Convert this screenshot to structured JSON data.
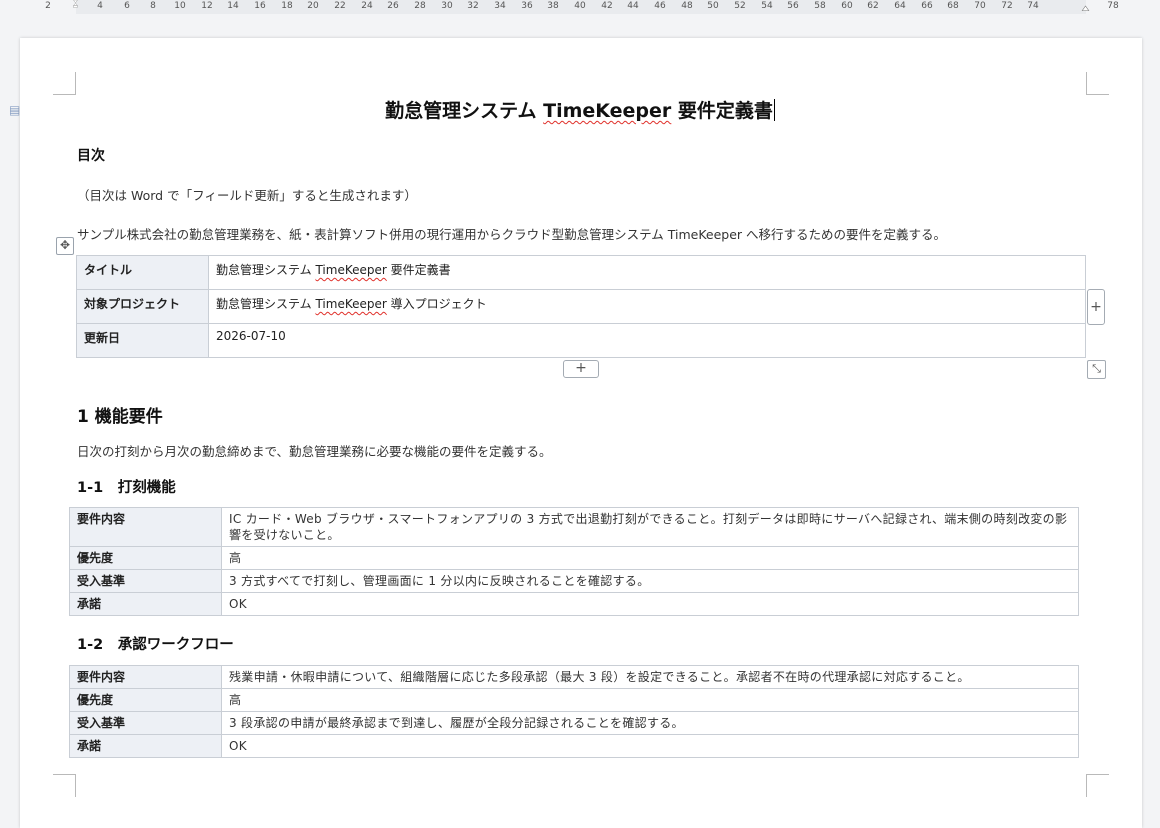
{
  "ruler": {
    "numbers": [
      "2",
      "2",
      "4",
      "6",
      "8",
      "10",
      "12",
      "14",
      "16",
      "18",
      "20",
      "22",
      "24",
      "26",
      "28",
      "30",
      "32",
      "34",
      "36",
      "38",
      "40",
      "42",
      "44",
      "46",
      "48",
      "50",
      "52",
      "54",
      "56",
      "58",
      "60",
      "62",
      "64",
      "66",
      "68",
      "70",
      "72",
      "74",
      "78"
    ]
  },
  "document": {
    "title_pre": "勤怠管理システム ",
    "title_brand": "TimeKeeper",
    "title_post": " 要件定義書",
    "toc_heading": "目次",
    "toc_note": "（目次は Word で「フィールド更新」すると生成されます）",
    "intro": "サンプル株式会社の勤怠管理業務を、紙・表計算ソフト併用の現行運用からクラウド型勤怠管理システム TimeKeeper へ移行するための要件を定義する。"
  },
  "meta_table": {
    "rows": [
      {
        "label": "タイトル",
        "value_pre": "勤怠管理システム ",
        "value_brand": "TimeKeeper",
        "value_post": " 要件定義書"
      },
      {
        "label": "対象プロジェクト",
        "value_pre": "勤怠管理システム ",
        "value_brand": "TimeKeeper",
        "value_post": " 導入プロジェクト"
      },
      {
        "label": "更新日",
        "value_pre": "2026-07-10",
        "value_brand": "",
        "value_post": ""
      }
    ]
  },
  "section1": {
    "heading": "1  機能要件",
    "description": "日次の打刻から月次の勤怠締めまで、勤怠管理業務に必要な機能の要件を定義する。",
    "sub1": {
      "heading": "1-1　打刻機能",
      "rows": [
        {
          "label": "要件内容",
          "value": "IC カード・Web ブラウザ・スマートフォンアプリの 3 方式で出退勤打刻ができること。打刻データは即時にサーバへ記録され、端末側の時刻改変の影響を受けないこと。"
        },
        {
          "label": "優先度",
          "value": "高"
        },
        {
          "label": "受入基準",
          "value": "3 方式すべてで打刻し、管理画面に 1 分以内に反映されることを確認する。"
        },
        {
          "label": "承諾",
          "value": "OK"
        }
      ]
    },
    "sub2": {
      "heading": "1-2　承認ワークフロー",
      "rows": [
        {
          "label": "要件内容",
          "value": "残業申請・休暇申請について、組織階層に応じた多段承認（最大 3 段）を設定できること。承認者不在時の代理承認に対応すること。"
        },
        {
          "label": "優先度",
          "value": "高"
        },
        {
          "label": "受入基準",
          "value": "3 段承認の申請が最終承認まで到達し、履歴が全段分記録されることを確認する。"
        },
        {
          "label": "承諾",
          "value": "OK"
        }
      ]
    }
  },
  "controls": {
    "add_column": "+",
    "add_row": "+",
    "resize": "⤡",
    "move": "✥"
  }
}
